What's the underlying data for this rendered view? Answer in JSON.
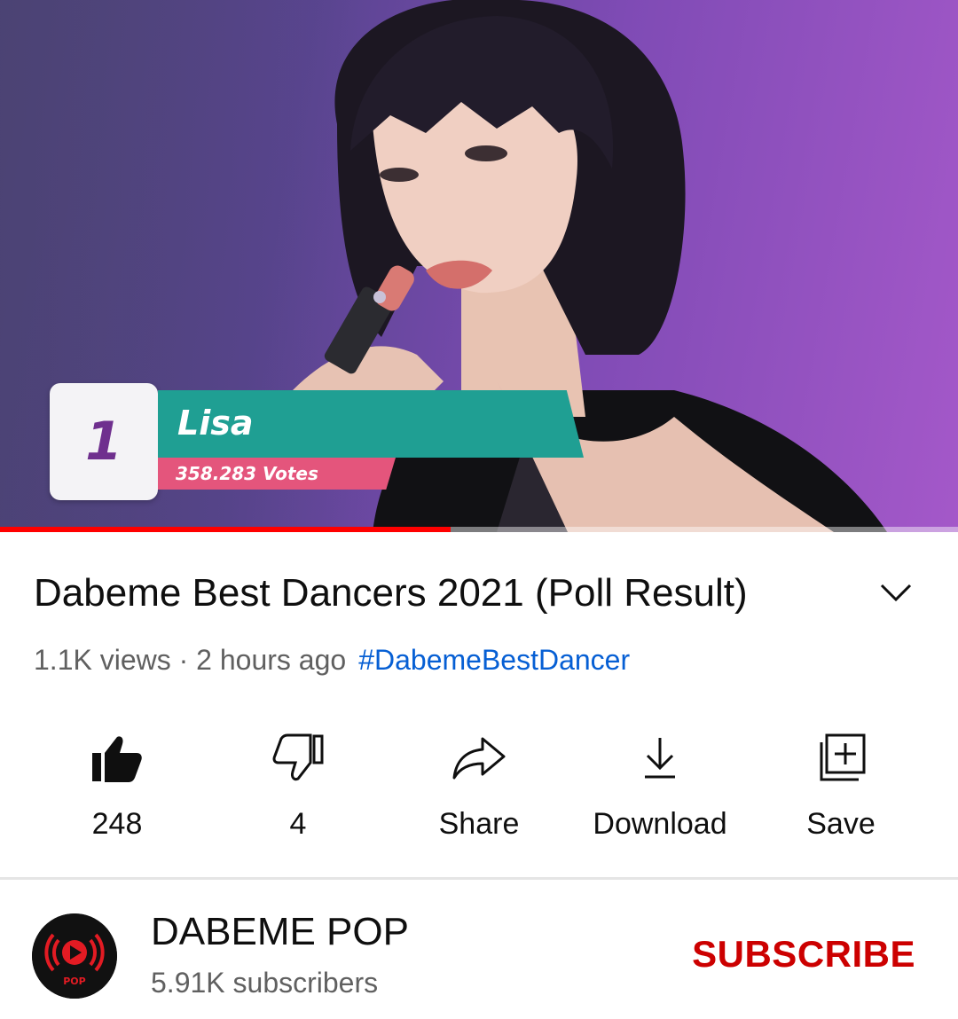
{
  "player": {
    "overlay": {
      "rank": "1",
      "name": "Lisa",
      "votes": "358.283 Votes"
    },
    "progress": 0.47
  },
  "video": {
    "title": "Dabeme Best Dancers 2021 (Poll Result)",
    "meta": "1.1K views · 2 hours ago",
    "hashtag": "#DabemeBestDancer"
  },
  "actions": {
    "like": {
      "label": "248",
      "icon": "thumbs-up-icon"
    },
    "dislike": {
      "label": "4",
      "icon": "thumbs-down-icon"
    },
    "share": {
      "label": "Share",
      "icon": "share-icon"
    },
    "download": {
      "label": "Download",
      "icon": "download-icon"
    },
    "save": {
      "label": "Save",
      "icon": "save-playlist-icon"
    }
  },
  "channel": {
    "name": "DABEME POP",
    "subscribers": "5.91K subscribers",
    "logo_text": "POP",
    "subscribe_label": "SUBSCRIBE"
  },
  "colors": {
    "accent_red": "#cc0000",
    "progress_red": "#ff0000",
    "hashtag_blue": "#065fd4",
    "overlay_teal": "#1f9f93",
    "overlay_pink": "#e4557c",
    "rank_purple": "#6f2f8e"
  }
}
